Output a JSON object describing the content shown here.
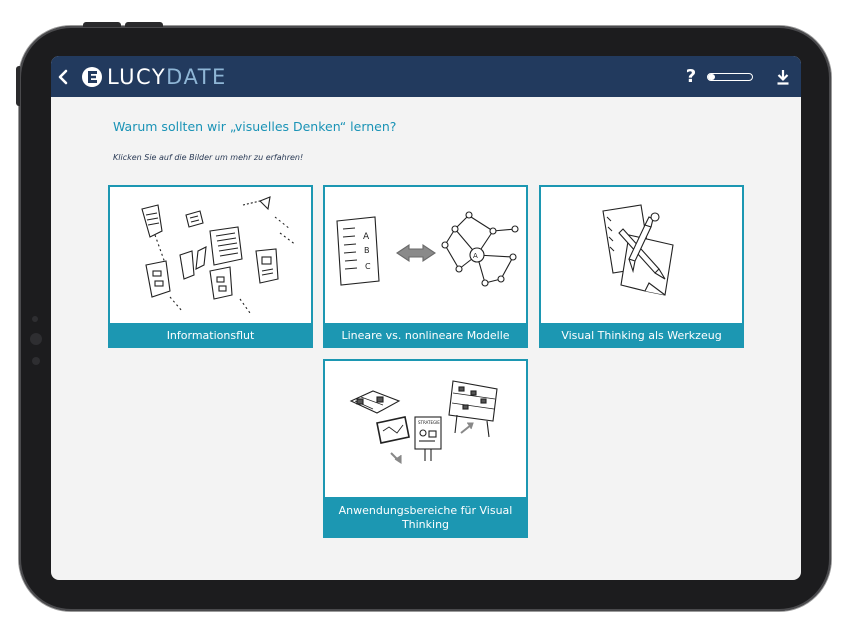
{
  "app": {
    "logo": {
      "part1": "LUCY",
      "part2": "DATE",
      "icon": "lucydate-logo-mark"
    },
    "help_label": "?",
    "progress_fraction": 0.15,
    "icons": {
      "back": "chevron-left-icon",
      "download": "download-icon"
    },
    "colors": {
      "topbar": "#223a5e",
      "accent": "#1c97b2",
      "heading": "#1a93b6"
    }
  },
  "page": {
    "heading": "Warum sollten wir „visuelles Denken“ lernen?",
    "instruction": "Klicken Sie auf die Bilder um mehr zu erfahren!"
  },
  "cards": [
    {
      "caption": "Informationsflut",
      "image": "scattered-papers-illustration"
    },
    {
      "caption": "Lineare vs. nonlineare Modelle",
      "image": "list-vs-network-illustration"
    },
    {
      "caption": "Visual Thinking als Werkzeug",
      "image": "pen-and-paper-illustration"
    },
    {
      "caption": "Anwendungsbereiche für Visual Thinking",
      "image": "boards-and-notebook-illustration"
    }
  ]
}
